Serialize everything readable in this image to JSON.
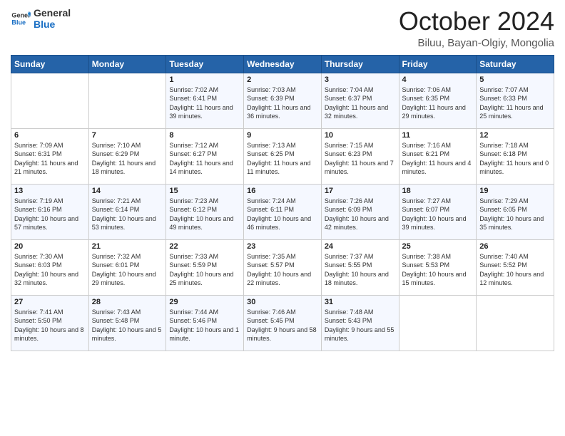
{
  "logo": {
    "line1": "General",
    "line2": "Blue"
  },
  "title": "October 2024",
  "location": "Biluu, Bayan-Olgiy, Mongolia",
  "weekdays": [
    "Sunday",
    "Monday",
    "Tuesday",
    "Wednesday",
    "Thursday",
    "Friday",
    "Saturday"
  ],
  "weeks": [
    [
      {
        "day": "",
        "info": ""
      },
      {
        "day": "",
        "info": ""
      },
      {
        "day": "1",
        "info": "Sunrise: 7:02 AM\nSunset: 6:41 PM\nDaylight: 11 hours and 39 minutes."
      },
      {
        "day": "2",
        "info": "Sunrise: 7:03 AM\nSunset: 6:39 PM\nDaylight: 11 hours and 36 minutes."
      },
      {
        "day": "3",
        "info": "Sunrise: 7:04 AM\nSunset: 6:37 PM\nDaylight: 11 hours and 32 minutes."
      },
      {
        "day": "4",
        "info": "Sunrise: 7:06 AM\nSunset: 6:35 PM\nDaylight: 11 hours and 29 minutes."
      },
      {
        "day": "5",
        "info": "Sunrise: 7:07 AM\nSunset: 6:33 PM\nDaylight: 11 hours and 25 minutes."
      }
    ],
    [
      {
        "day": "6",
        "info": "Sunrise: 7:09 AM\nSunset: 6:31 PM\nDaylight: 11 hours and 21 minutes."
      },
      {
        "day": "7",
        "info": "Sunrise: 7:10 AM\nSunset: 6:29 PM\nDaylight: 11 hours and 18 minutes."
      },
      {
        "day": "8",
        "info": "Sunrise: 7:12 AM\nSunset: 6:27 PM\nDaylight: 11 hours and 14 minutes."
      },
      {
        "day": "9",
        "info": "Sunrise: 7:13 AM\nSunset: 6:25 PM\nDaylight: 11 hours and 11 minutes."
      },
      {
        "day": "10",
        "info": "Sunrise: 7:15 AM\nSunset: 6:23 PM\nDaylight: 11 hours and 7 minutes."
      },
      {
        "day": "11",
        "info": "Sunrise: 7:16 AM\nSunset: 6:21 PM\nDaylight: 11 hours and 4 minutes."
      },
      {
        "day": "12",
        "info": "Sunrise: 7:18 AM\nSunset: 6:18 PM\nDaylight: 11 hours and 0 minutes."
      }
    ],
    [
      {
        "day": "13",
        "info": "Sunrise: 7:19 AM\nSunset: 6:16 PM\nDaylight: 10 hours and 57 minutes."
      },
      {
        "day": "14",
        "info": "Sunrise: 7:21 AM\nSunset: 6:14 PM\nDaylight: 10 hours and 53 minutes."
      },
      {
        "day": "15",
        "info": "Sunrise: 7:23 AM\nSunset: 6:12 PM\nDaylight: 10 hours and 49 minutes."
      },
      {
        "day": "16",
        "info": "Sunrise: 7:24 AM\nSunset: 6:11 PM\nDaylight: 10 hours and 46 minutes."
      },
      {
        "day": "17",
        "info": "Sunrise: 7:26 AM\nSunset: 6:09 PM\nDaylight: 10 hours and 42 minutes."
      },
      {
        "day": "18",
        "info": "Sunrise: 7:27 AM\nSunset: 6:07 PM\nDaylight: 10 hours and 39 minutes."
      },
      {
        "day": "19",
        "info": "Sunrise: 7:29 AM\nSunset: 6:05 PM\nDaylight: 10 hours and 35 minutes."
      }
    ],
    [
      {
        "day": "20",
        "info": "Sunrise: 7:30 AM\nSunset: 6:03 PM\nDaylight: 10 hours and 32 minutes."
      },
      {
        "day": "21",
        "info": "Sunrise: 7:32 AM\nSunset: 6:01 PM\nDaylight: 10 hours and 29 minutes."
      },
      {
        "day": "22",
        "info": "Sunrise: 7:33 AM\nSunset: 5:59 PM\nDaylight: 10 hours and 25 minutes."
      },
      {
        "day": "23",
        "info": "Sunrise: 7:35 AM\nSunset: 5:57 PM\nDaylight: 10 hours and 22 minutes."
      },
      {
        "day": "24",
        "info": "Sunrise: 7:37 AM\nSunset: 5:55 PM\nDaylight: 10 hours and 18 minutes."
      },
      {
        "day": "25",
        "info": "Sunrise: 7:38 AM\nSunset: 5:53 PM\nDaylight: 10 hours and 15 minutes."
      },
      {
        "day": "26",
        "info": "Sunrise: 7:40 AM\nSunset: 5:52 PM\nDaylight: 10 hours and 12 minutes."
      }
    ],
    [
      {
        "day": "27",
        "info": "Sunrise: 7:41 AM\nSunset: 5:50 PM\nDaylight: 10 hours and 8 minutes."
      },
      {
        "day": "28",
        "info": "Sunrise: 7:43 AM\nSunset: 5:48 PM\nDaylight: 10 hours and 5 minutes."
      },
      {
        "day": "29",
        "info": "Sunrise: 7:44 AM\nSunset: 5:46 PM\nDaylight: 10 hours and 1 minute."
      },
      {
        "day": "30",
        "info": "Sunrise: 7:46 AM\nSunset: 5:45 PM\nDaylight: 9 hours and 58 minutes."
      },
      {
        "day": "31",
        "info": "Sunrise: 7:48 AM\nSunset: 5:43 PM\nDaylight: 9 hours and 55 minutes."
      },
      {
        "day": "",
        "info": ""
      },
      {
        "day": "",
        "info": ""
      }
    ]
  ]
}
